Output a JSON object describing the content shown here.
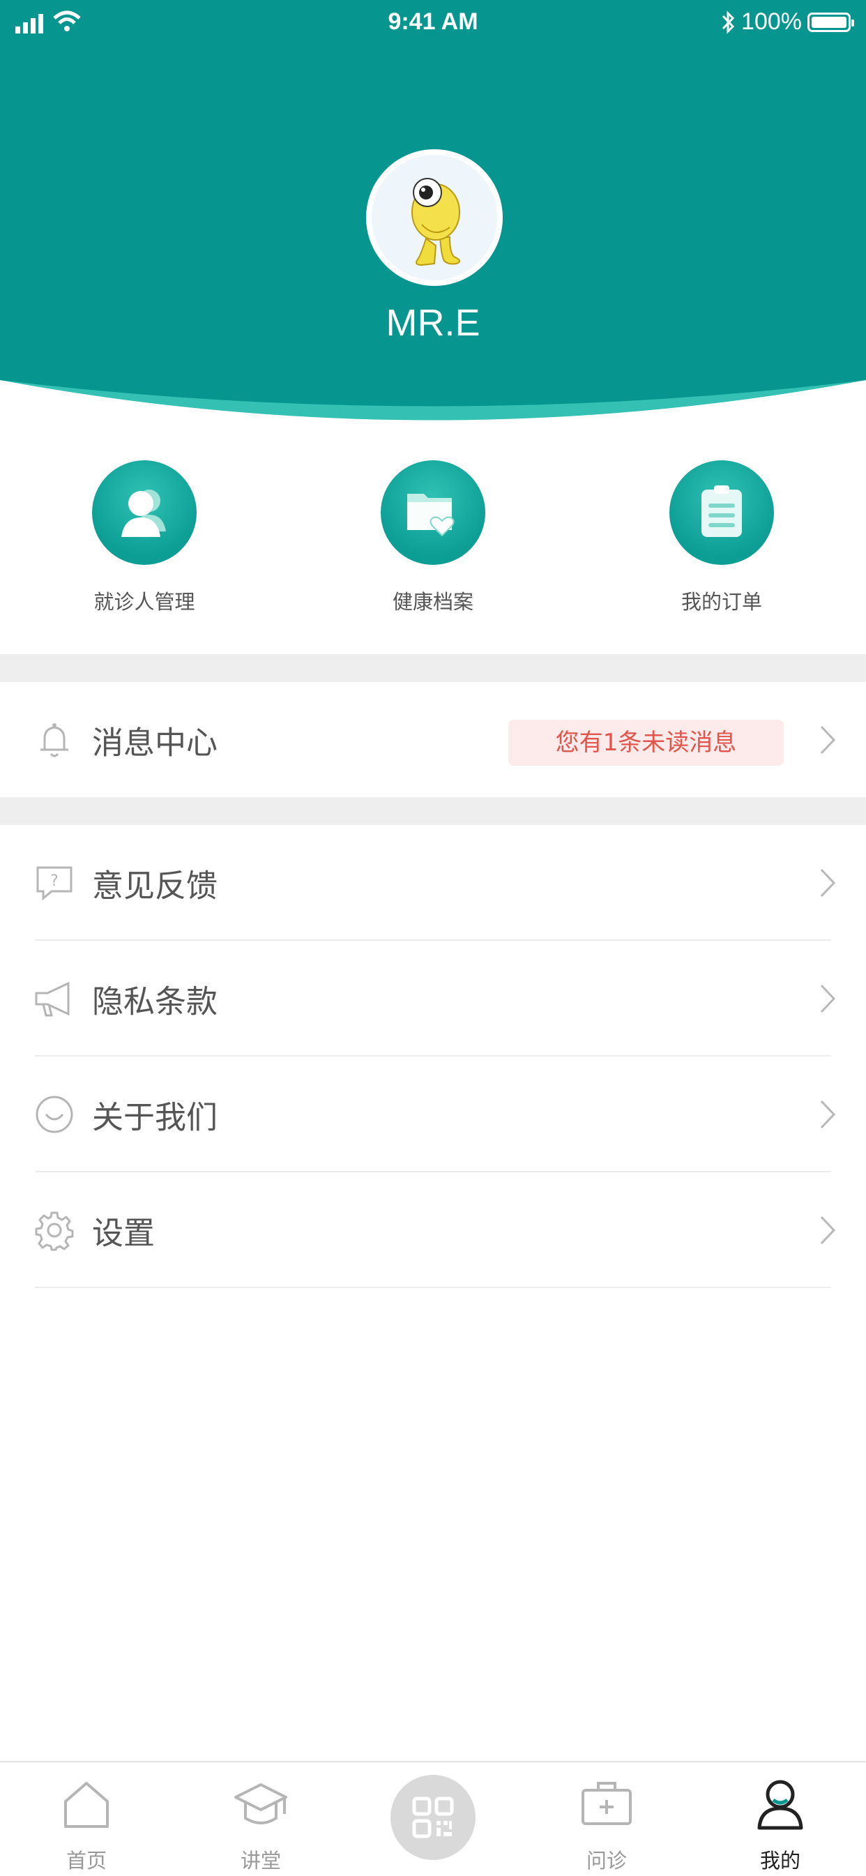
{
  "status_bar": {
    "time": "9:41 AM",
    "battery": "100%"
  },
  "profile": {
    "username": "MR.E"
  },
  "quick_actions": [
    {
      "label": "就诊人管理",
      "icon": "patients-icon"
    },
    {
      "label": "健康档案",
      "icon": "health-folder-icon"
    },
    {
      "label": "我的订单",
      "icon": "clipboard-icon"
    }
  ],
  "message_center": {
    "label": "消息中心",
    "badge": "您有1条未读消息",
    "icon": "bell-icon"
  },
  "menu": [
    {
      "label": "意见反馈",
      "icon": "feedback-icon"
    },
    {
      "label": "隐私条款",
      "icon": "megaphone-icon"
    },
    {
      "label": "关于我们",
      "icon": "smile-icon"
    },
    {
      "label": "设置",
      "icon": "gear-icon"
    }
  ],
  "tabbar": {
    "items": [
      {
        "label": "首页",
        "icon": "home-icon"
      },
      {
        "label": "讲堂",
        "icon": "graduation-cap-icon"
      },
      {
        "label": "问诊",
        "icon": "medical-kit-icon"
      },
      {
        "label": "我的",
        "icon": "user-icon"
      }
    ],
    "active": "我的",
    "center_icon": "qr-code-icon"
  },
  "colors": {
    "primary": "#06968F",
    "accent_light": "#34C1B4",
    "badge_bg": "#FDEAEA",
    "badge_text": "#E2554A"
  }
}
